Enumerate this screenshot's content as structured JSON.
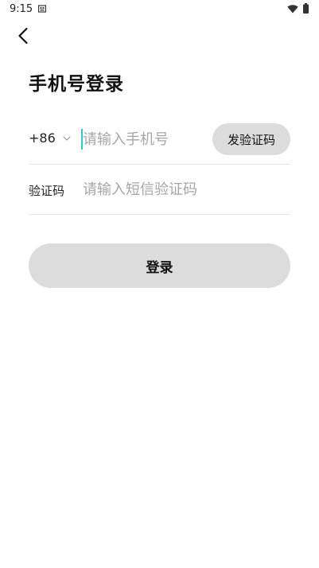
{
  "status_bar": {
    "time": "9:15",
    "notification_icon": "sim-notification-icon",
    "wifi_icon": "wifi-icon",
    "battery_icon": "battery-icon"
  },
  "nav": {
    "back_icon": "back-arrow-icon"
  },
  "page": {
    "title": "手机号登录"
  },
  "phone": {
    "country_code": "+86",
    "chevron_icon": "chevron-down-icon",
    "value": "",
    "placeholder": "请输入手机号",
    "send_code_label": "发验证码"
  },
  "code": {
    "label": "验证码",
    "value": "",
    "placeholder": "请输入短信验证码"
  },
  "actions": {
    "login_label": "登录"
  },
  "colors": {
    "button_bg": "#dcdcdc",
    "caret": "#2fc7d6",
    "placeholder": "#a6a6a6",
    "divider": "#e8e8e8"
  }
}
